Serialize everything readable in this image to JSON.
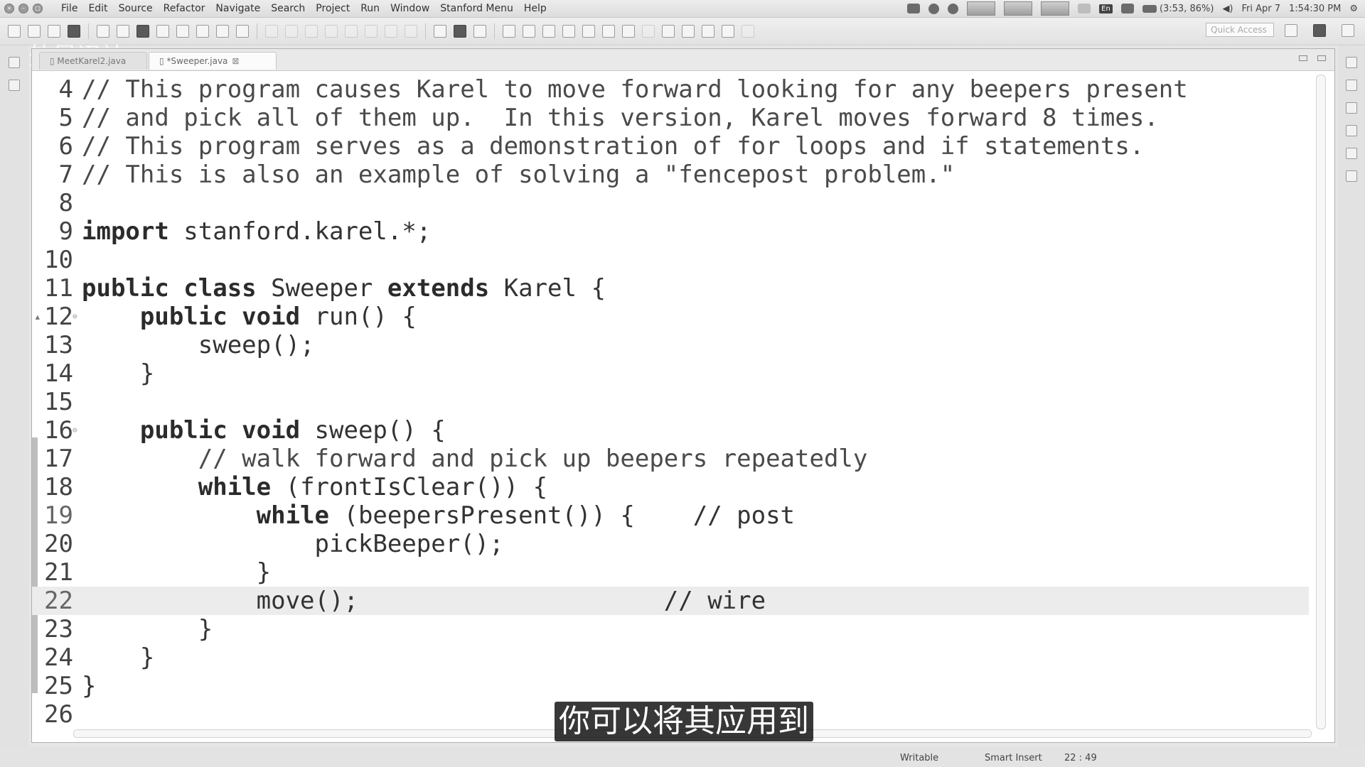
{
  "menubar": {
    "items": [
      "File",
      "Edit",
      "Source",
      "Refactor",
      "Navigate",
      "Search",
      "Project",
      "Run",
      "Window",
      "Stanford Menu",
      "Help"
    ],
    "tray": {
      "lang": "En",
      "battery": "(3:53, 86%)",
      "date": "Fri Apr 7",
      "time": "1:54:30 PM"
    }
  },
  "toolbar": {
    "quick_access_placeholder": "Quick Access"
  },
  "tabs": [
    {
      "label": "MeetKarel2.java",
      "active": false
    },
    {
      "label": "*Sweeper.java",
      "close": "⊠",
      "active": true
    }
  ],
  "editor": {
    "lines": [
      {
        "n": "4",
        "text": "// This program causes Karel to move forward looking for any beepers present",
        "type": "comment"
      },
      {
        "n": "5",
        "text": "// and pick all of them up.  In this version, Karel moves forward 8 times.",
        "type": "comment"
      },
      {
        "n": "6",
        "text": "// This program serves as a demonstration of for loops and if statements.",
        "type": "comment"
      },
      {
        "n": "7",
        "text": "// This is also an example of solving a \"fencepost problem.\"",
        "type": "comment"
      },
      {
        "n": "8",
        "text": "",
        "type": "plain"
      },
      {
        "n": "9",
        "kw": "import",
        "rest": " stanford.karel.*;",
        "type": "kw"
      },
      {
        "n": "10",
        "text": "",
        "type": "plain"
      },
      {
        "n": "11",
        "kw": "public class",
        "mid": " Sweeper ",
        "kw2": "extends",
        "rest": " Karel {",
        "type": "kw2"
      },
      {
        "n": "12",
        "indent": "    ",
        "kw": "public void",
        "rest": " run() {",
        "type": "kw",
        "marker": "▴",
        "fold": "⊖"
      },
      {
        "n": "13",
        "text": "        sweep();",
        "type": "plain"
      },
      {
        "n": "14",
        "text": "    }",
        "type": "plain"
      },
      {
        "n": "15",
        "text": "",
        "type": "plain"
      },
      {
        "n": "16",
        "indent": "    ",
        "kw": "public void",
        "rest": " sweep() {",
        "type": "kw",
        "fold": "⊖"
      },
      {
        "n": "17",
        "text": "        // walk forward and pick up beepers repeatedly",
        "type": "comment"
      },
      {
        "n": "18",
        "indent": "        ",
        "kw": "while",
        "rest": " (frontIsClear()) {",
        "type": "kw"
      },
      {
        "n": "19",
        "indent": "            ",
        "kw": "while",
        "rest": " (beepersPresent()) {    // post",
        "type": "kw",
        "hl": true
      },
      {
        "n": "20",
        "text": "                pickBeeper();",
        "type": "plain"
      },
      {
        "n": "21",
        "text": "            }",
        "type": "plain"
      },
      {
        "n": "22",
        "text": "            move();                     // wire",
        "type": "plain",
        "current": true,
        "hl": true
      },
      {
        "n": "23",
        "text": "        }",
        "type": "plain"
      },
      {
        "n": "24",
        "text": "    }",
        "type": "plain"
      },
      {
        "n": "25",
        "text": "}",
        "type": "plain"
      },
      {
        "n": "26",
        "text": "",
        "type": "plain"
      }
    ]
  },
  "status": {
    "writable": "Writable",
    "insert_mode": "Smart Insert",
    "position": "22 : 49"
  },
  "subtitle": "你可以将其应用到",
  "watermark": "外星译站"
}
